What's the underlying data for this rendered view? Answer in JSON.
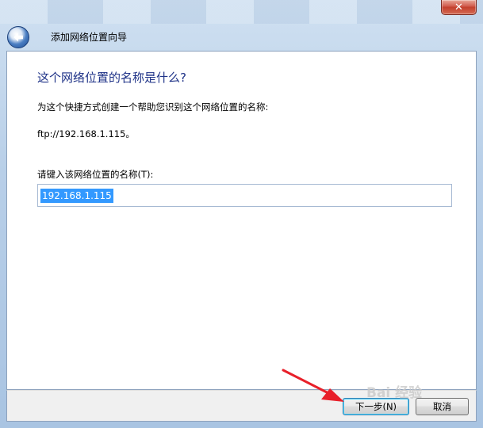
{
  "window": {
    "close_glyph": "✕",
    "wizard_title": "添加网络位置向导"
  },
  "page": {
    "heading": "这个网络位置的名称是什么?",
    "description": "为这个快捷方式创建一个帮助您识别这个网络位置的名称:",
    "address": "ftp://192.168.1.115。",
    "name_label": "请键入该网络位置的名称(T):",
    "name_value": "192.168.1.115"
  },
  "footer": {
    "next_label": "下一步(N)",
    "cancel_label": "取消"
  },
  "watermark": "Bai 经验",
  "colors": {
    "heading": "#1e3287",
    "selection": "#3399ff",
    "arrow": "#e8202a"
  },
  "icons": {
    "back": "back-arrow-icon",
    "close": "close-icon",
    "annotation": "red-arrow-icon"
  }
}
